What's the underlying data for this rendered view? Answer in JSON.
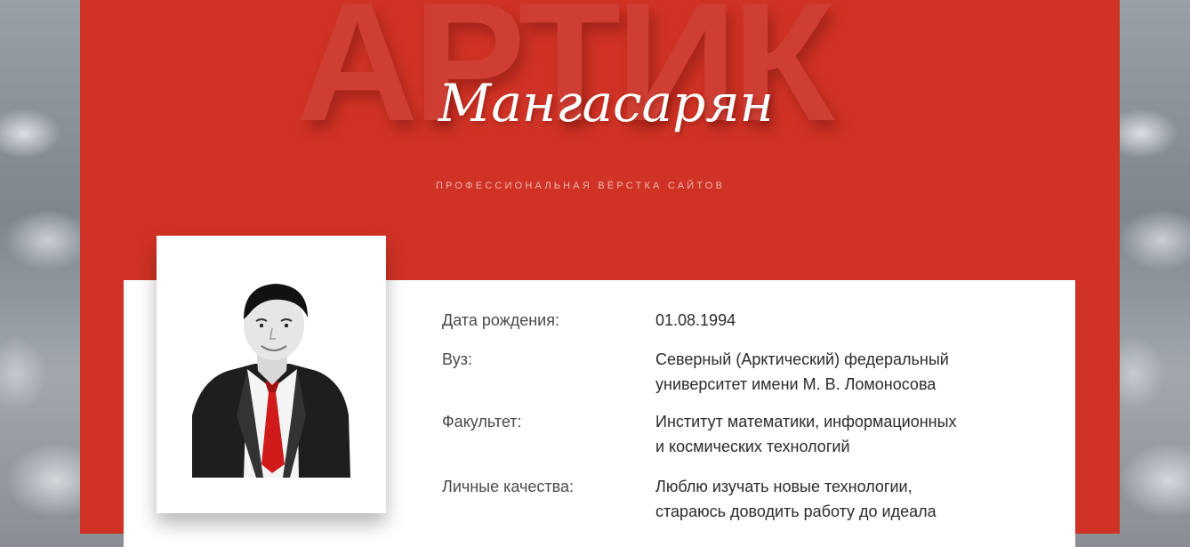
{
  "header": {
    "background_word": "АРТИК",
    "surname": "Мангасарян",
    "tagline": "ПРОФЕССИОНАЛЬНАЯ ВЁРСТКА САЙТОВ"
  },
  "colors": {
    "accent_red": "#d03325",
    "card": "#ffffff",
    "text": "#2b2b2b"
  },
  "profile": {
    "photo_icon": "person-photo",
    "rows": [
      {
        "label": "Дата рождения:",
        "value": [
          "01.08.1994"
        ]
      },
      {
        "label": "Вуз:",
        "value": [
          "Северный (Арктический) федеральный",
          "университет имени М. В. Ломоносова"
        ]
      },
      {
        "label": "Факультет:",
        "value": [
          "Институт математики, информационных",
          "и космических технологий"
        ]
      },
      {
        "label": "Личные качества:",
        "value": [
          "Люблю изучать новые технологии,",
          "стараюсь доводить работу до идеала"
        ]
      }
    ]
  }
}
